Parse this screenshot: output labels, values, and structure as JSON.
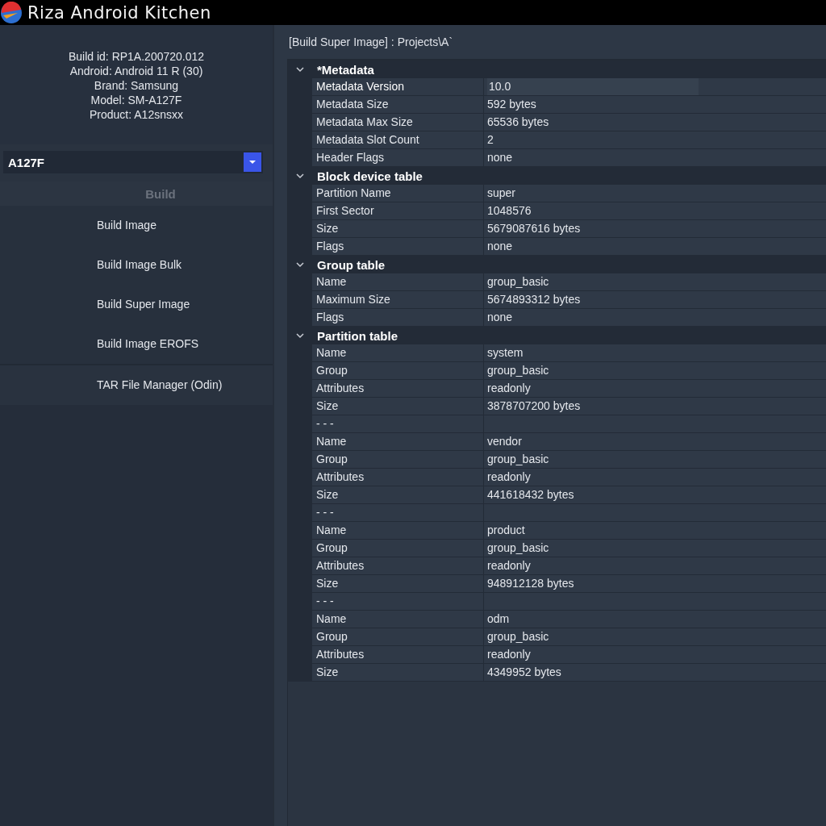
{
  "window": {
    "title": "Riza Android Kitchen"
  },
  "device_info": [
    "Build id: RP1A.200720.012",
    "Android: Android 11 R (30)",
    "Brand: Samsung",
    "Model: SM-A127F",
    "Product: A12snsxx"
  ],
  "device_select": {
    "value": "A127F"
  },
  "menu": {
    "header": "Build",
    "header_disabled": true,
    "groups": [
      [
        "Build Image",
        "Build Image Bulk",
        "Build Super Image",
        "Build Image EROFS"
      ],
      [
        "TAR File Manager (Odin)"
      ]
    ]
  },
  "breadcrumb": "[Build Super Image] : Projects\\A`",
  "property_grid": {
    "sections": [
      {
        "title": "*Metadata",
        "expanded": true,
        "rows": [
          {
            "name": "Metadata Version",
            "value": "10.0",
            "selected": true
          },
          {
            "name": "Metadata Size",
            "value": "592 bytes",
            "selected": false
          },
          {
            "name": "Metadata Max Size",
            "value": "65536 bytes",
            "selected": false
          },
          {
            "name": "Metadata Slot Count",
            "value": "2",
            "selected": false
          },
          {
            "name": "Header Flags",
            "value": "none",
            "selected": false
          }
        ]
      },
      {
        "title": "Block device table",
        "expanded": true,
        "rows": [
          {
            "name": "Partition Name",
            "value": "super",
            "selected": false
          },
          {
            "name": "First Sector",
            "value": "1048576",
            "selected": false
          },
          {
            "name": "Size",
            "value": "5679087616 bytes",
            "selected": false
          },
          {
            "name": "Flags",
            "value": "none",
            "selected": false
          }
        ]
      },
      {
        "title": "Group table",
        "expanded": true,
        "rows": [
          {
            "name": "Name",
            "value": "group_basic",
            "selected": false
          },
          {
            "name": "Maximum Size",
            "value": "5674893312 bytes",
            "selected": false
          },
          {
            "name": "Flags",
            "value": "none",
            "selected": false
          }
        ]
      },
      {
        "title": "Partition table",
        "expanded": true,
        "rows": [
          {
            "name": "Name",
            "value": "system",
            "selected": false
          },
          {
            "name": "Group",
            "value": "group_basic",
            "selected": false
          },
          {
            "name": "Attributes",
            "value": "readonly",
            "selected": false
          },
          {
            "name": "Size",
            "value": "3878707200 bytes",
            "selected": false
          },
          {
            "name": "- - -",
            "selected": false
          },
          {
            "name": "Name",
            "value": "vendor",
            "selected": false
          },
          {
            "name": "Group",
            "value": "group_basic",
            "selected": false
          },
          {
            "name": "Attributes",
            "value": "readonly",
            "selected": false
          },
          {
            "name": "Size",
            "value": "441618432 bytes",
            "selected": false
          },
          {
            "name": "- - -",
            "selected": false
          },
          {
            "name": "Name",
            "value": "product",
            "selected": false
          },
          {
            "name": "Group",
            "value": "group_basic",
            "selected": false
          },
          {
            "name": "Attributes",
            "value": "readonly",
            "selected": false
          },
          {
            "name": "Size",
            "value": "948912128 bytes",
            "selected": false
          },
          {
            "name": "- - -",
            "selected": false
          },
          {
            "name": "Name",
            "value": "odm",
            "selected": false
          },
          {
            "name": "Group",
            "value": "group_basic",
            "selected": false
          },
          {
            "name": "Attributes",
            "value": "readonly",
            "selected": false
          },
          {
            "name": "Size",
            "value": "4349952 bytes",
            "selected": false
          }
        ]
      }
    ]
  }
}
